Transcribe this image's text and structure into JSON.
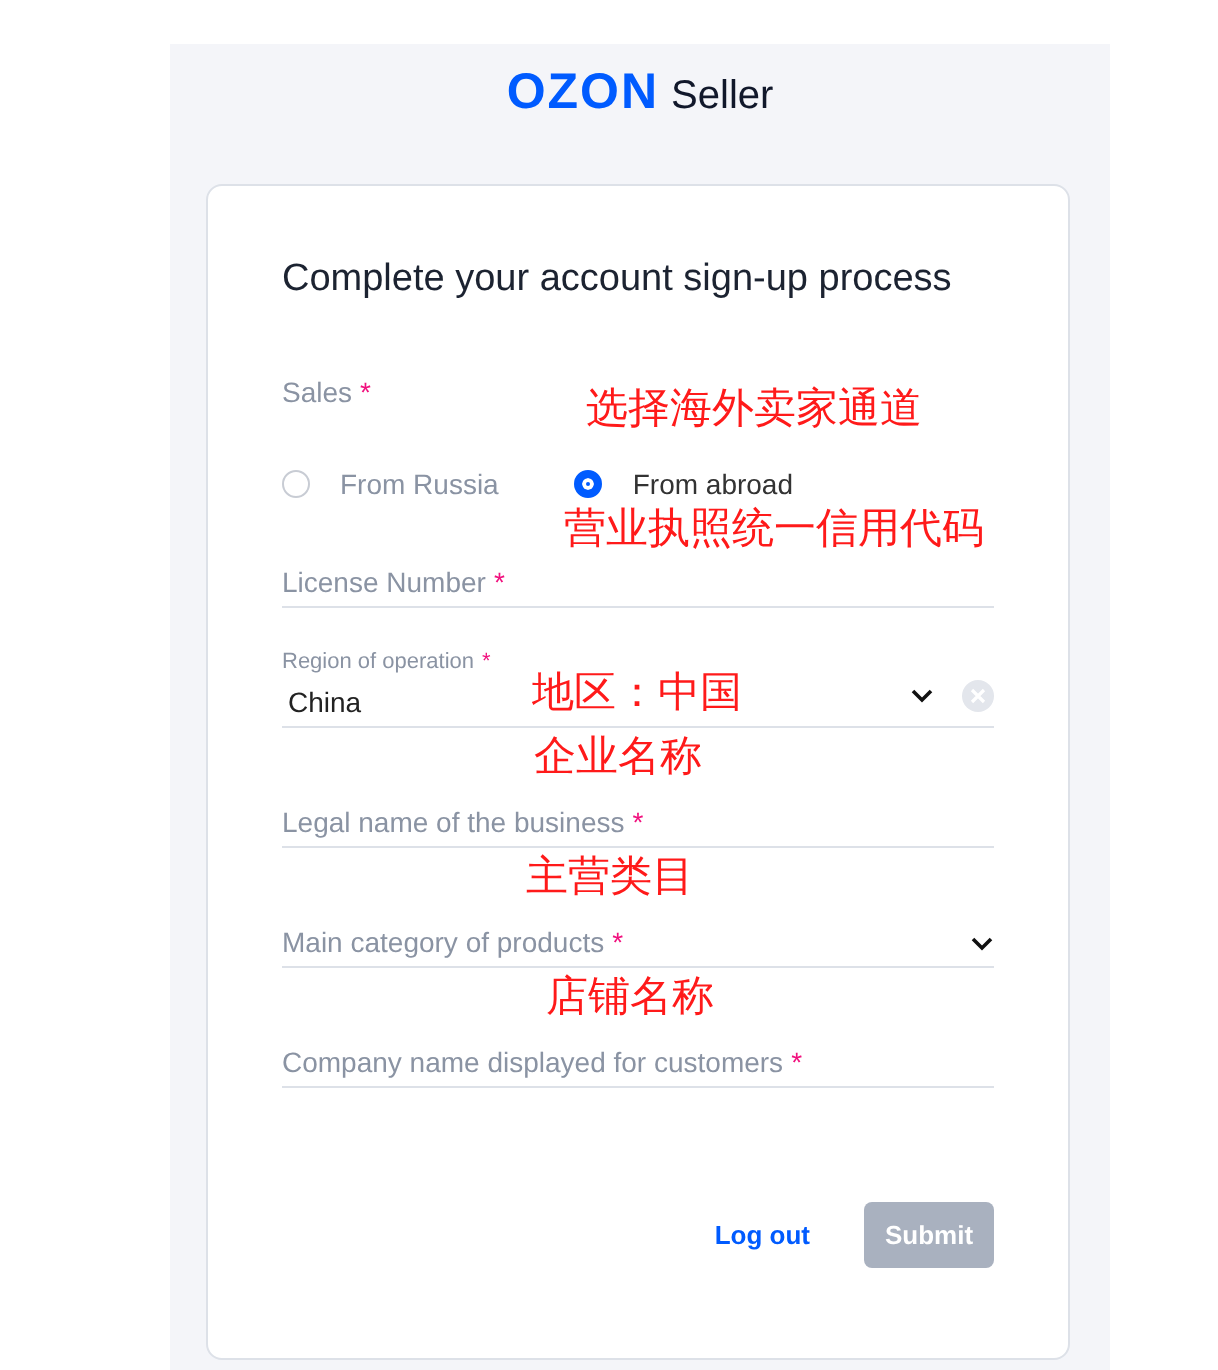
{
  "logo": {
    "brand": "OZON",
    "product": "Seller"
  },
  "form": {
    "title": "Complete your account sign-up process",
    "sales": {
      "label": "Sales",
      "required_mark": "*",
      "annotation": "选择海外卖家通道",
      "options": [
        {
          "label": "From Russia",
          "selected": false
        },
        {
          "label": "From abroad",
          "selected": true
        }
      ]
    },
    "fields": [
      {
        "kind": "text",
        "label": "License Number",
        "required_mark": "*",
        "annotation": "营业执照统一信用代码"
      },
      {
        "kind": "select",
        "label": "Region of operation",
        "required_mark": "*",
        "value": "China",
        "clearable": true,
        "annotation": "地区：中国"
      },
      {
        "kind": "text",
        "label": "Legal name of the business",
        "required_mark": "*",
        "annotation": "企业名称"
      },
      {
        "kind": "select",
        "label": "Main category of products",
        "required_mark": "*",
        "clearable": false,
        "annotation": "主营类目"
      },
      {
        "kind": "text",
        "label": "Company name displayed for customers",
        "required_mark": "*",
        "annotation": "店铺名称"
      }
    ],
    "actions": {
      "logout": "Log out",
      "submit": {
        "label": "Submit",
        "disabled": true
      }
    }
  }
}
